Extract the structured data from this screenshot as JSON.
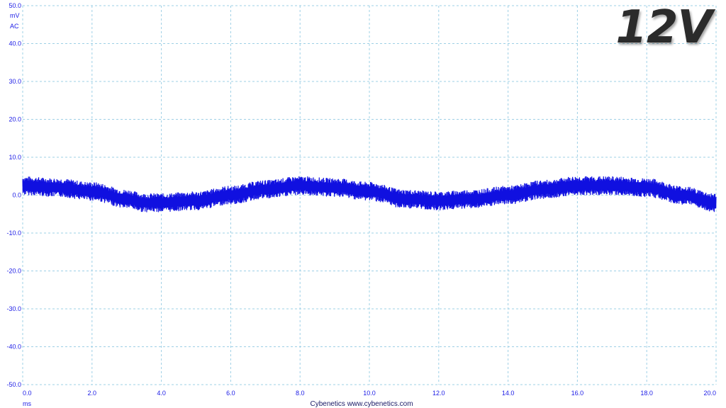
{
  "badge": "12V",
  "units": {
    "y_unit": "mV",
    "y_coupling": "AC",
    "x_unit": "ms"
  },
  "credit": "Cybenetics   www.cybenetics.com",
  "colors": {
    "trace": "#1010e0",
    "grid": "#9ed0e6",
    "ticks": "#1a1ae6"
  },
  "chart_data": {
    "type": "line",
    "xlim": [
      0.0,
      20.0
    ],
    "ylim": [
      -50.0,
      50.0
    ],
    "x_ticks": [
      "0.0",
      "2.0",
      "4.0",
      "6.0",
      "8.0",
      "10.0",
      "12.0",
      "14.0",
      "16.0",
      "18.0",
      "20.0"
    ],
    "y_ticks": [
      "50.0",
      "40.0",
      "30.0",
      "20.0",
      "10.0",
      "0.0",
      "-10.0",
      "-20.0",
      "-30.0",
      "-40.0",
      "-50.0"
    ],
    "grid": true,
    "series": [
      {
        "x": [
          0.0,
          1.0,
          2.0,
          3.0,
          3.5,
          4.0,
          5.0,
          6.0,
          7.0,
          8.0,
          9.0,
          10.0,
          11.0,
          12.0,
          13.0,
          14.0,
          15.0,
          16.0,
          17.0,
          18.0,
          19.0,
          20.0
        ],
        "y": [
          2.5,
          2.0,
          1.0,
          -1.0,
          -2.0,
          -2.0,
          -1.5,
          0.0,
          1.5,
          2.5,
          2.0,
          1.0,
          -1.0,
          -1.5,
          -1.0,
          0.0,
          1.5,
          2.5,
          2.5,
          2.0,
          0.0,
          -2.0
        ],
        "ripple_pp": 5.0
      }
    ]
  }
}
